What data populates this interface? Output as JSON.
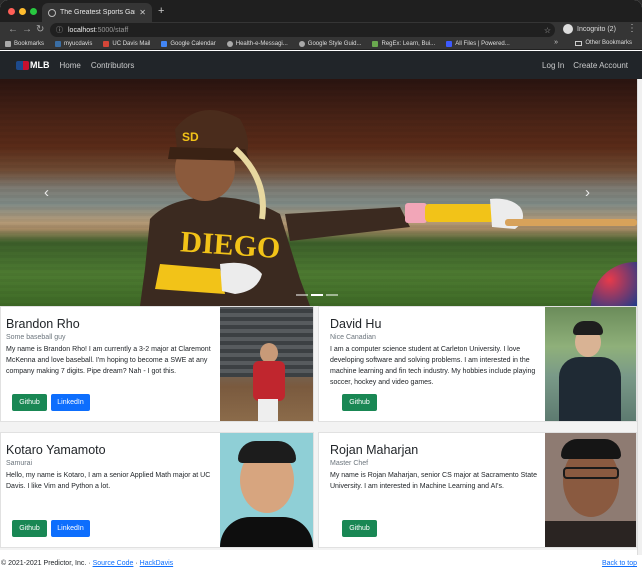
{
  "browser": {
    "tab_title": "The Greatest Sports Game Pre",
    "url_host": "localhost",
    "url_path": ":5000/staff",
    "profile_label": "Incognito (2)",
    "bookmarks": [
      {
        "label": "Bookmarks",
        "color": "#aaaaaa"
      },
      {
        "label": "myucdavis",
        "color": "#3a6ea5"
      },
      {
        "label": "UC Davis Mail",
        "color": "#d44638"
      },
      {
        "label": "Google Calendar",
        "color": "#4285f4"
      },
      {
        "label": "Health-e-Messagi...",
        "color": "#aaaaaa"
      },
      {
        "label": "Google Style Guid...",
        "color": "#aaaaaa"
      },
      {
        "label": "RegEx: Learn, Bui...",
        "color": "#6aa84f"
      },
      {
        "label": "All Files | Powered...",
        "color": "#3d5afe"
      }
    ],
    "bookmarks_more": "»",
    "other_bookmarks": "Other Bookmarks"
  },
  "nav": {
    "brand": "MLB",
    "links": [
      "Home",
      "Contributors"
    ],
    "right_links": [
      "Log In",
      "Create Account"
    ]
  },
  "carousel": {
    "prev": "‹",
    "next": "›",
    "slides": 3,
    "active": 1
  },
  "staff": [
    {
      "name": "Brandon Rho",
      "subtitle": "Some baseball guy",
      "bio": "My name is Brandon Rho! I am currently a 3-2 major at Claremont McKenna and love baseball. I'm hoping to become a SWE at any company making 7 digits. Pipe dream? Nah - I got this.",
      "buttons": [
        "Github",
        "LinkedIn"
      ]
    },
    {
      "name": "David Hu",
      "subtitle": "Nice Canadian",
      "bio": "I am a computer science student at Carleton University. I love developing software and solving problems. I am interested in the machine learning and fin tech industry. My hobbies include playing soccer, hockey and video games.",
      "buttons": [
        "Github"
      ]
    },
    {
      "name": "Kotaro Yamamoto",
      "subtitle": "Samurai",
      "bio": "Hello, my name is Kotaro, I am a senior Applied Math major at UC Davis. I like Vim and Python a lot.",
      "buttons": [
        "Github",
        "LinkedIn"
      ]
    },
    {
      "name": "Rojan Maharjan",
      "subtitle": "Master Chef",
      "bio": "My name is Rojan Maharjan, senior CS major at Sacramento State University. I am interested in Machine Learning and AI's.",
      "buttons": [
        "Github"
      ]
    }
  ],
  "footer": {
    "copyright": "© 2021-2021 Predictor, Inc. ·",
    "separator": "·",
    "source_link": "Source Code",
    "hack_link": "HackDavis",
    "back_to_top": "Back to top"
  },
  "colors": {
    "navbar": "#212529",
    "github": "#198754",
    "linkedin": "#0d6efd"
  }
}
